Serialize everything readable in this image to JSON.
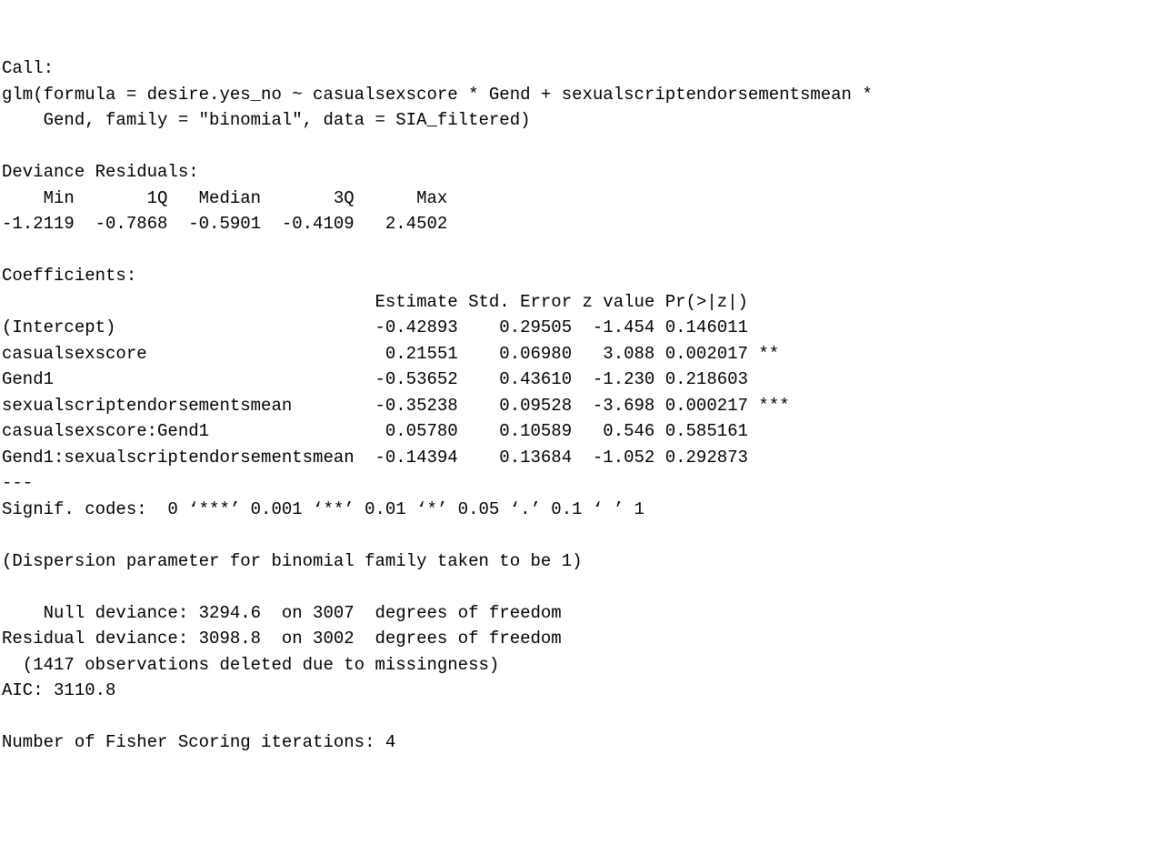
{
  "call_label": "Call:",
  "call_line1": "glm(formula = desire.yes_no ~ casualsexscore * Gend + sexualscriptendorsementsmean * ",
  "call_line2": "    Gend, family = \"binomial\", data = SIA_filtered)",
  "dev_res_label": "Deviance Residuals: ",
  "dev_res_header": "    Min       1Q   Median       3Q      Max  ",
  "dev_res_values": "-1.2119  -0.7868  -0.5901  -0.4109   2.4502  ",
  "coef_label": "Coefficients:",
  "coef_header": "                                    Estimate Std. Error z value Pr(>|z|)    ",
  "coef_row0": "(Intercept)                         -0.42893    0.29505  -1.454 0.146011    ",
  "coef_row1": "casualsexscore                       0.21551    0.06980   3.088 0.002017 ** ",
  "coef_row2": "Gend1                               -0.53652    0.43610  -1.230 0.218603    ",
  "coef_row3": "sexualscriptendorsementsmean        -0.35238    0.09528  -3.698 0.000217 ***",
  "coef_row4": "casualsexscore:Gend1                 0.05780    0.10589   0.546 0.585161    ",
  "coef_row5": "Gend1:sexualscriptendorsementsmean  -0.14394    0.13684  -1.052 0.292873    ",
  "sep": "---",
  "signif_codes": "Signif. codes:  0 ‘***’ 0.001 ‘**’ 0.01 ‘*’ 0.05 ‘.’ 0.1 ‘ ’ 1",
  "dispersion": "(Dispersion parameter for binomial family taken to be 1)",
  "null_dev": "    Null deviance: 3294.6  on 3007  degrees of freedom",
  "resid_dev": "Residual deviance: 3098.8  on 3002  degrees of freedom",
  "missingness": "  (1417 observations deleted due to missingness)",
  "aic": "AIC: 3110.8",
  "fisher": "Number of Fisher Scoring iterations: 4"
}
